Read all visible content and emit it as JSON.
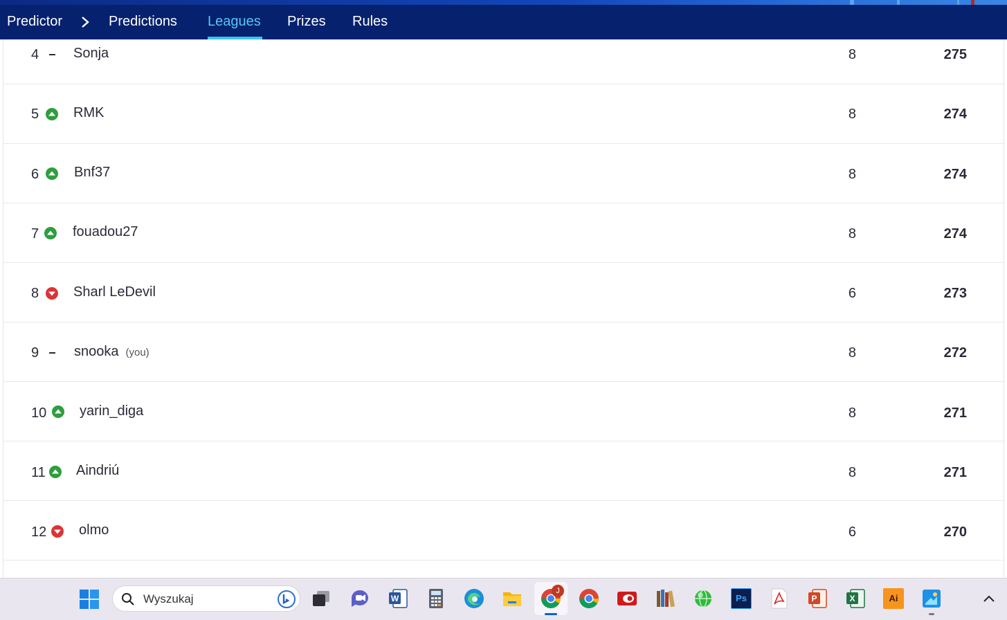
{
  "nav": {
    "breadcrumb_root": "Predictor",
    "tabs": [
      {
        "label": "Predictions",
        "active": false
      },
      {
        "label": "Leagues",
        "active": true
      },
      {
        "label": "Prizes",
        "active": false
      },
      {
        "label": "Rules",
        "active": false
      }
    ]
  },
  "standings": [
    {
      "rank": "4",
      "movement": "same",
      "name": "Sonja",
      "you": "",
      "value": "8",
      "points": "275"
    },
    {
      "rank": "5",
      "movement": "up",
      "name": "RMK",
      "you": "",
      "value": "8",
      "points": "274"
    },
    {
      "rank": "6",
      "movement": "up",
      "name": "Bnf37",
      "you": "",
      "value": "8",
      "points": "274"
    },
    {
      "rank": "7",
      "movement": "up",
      "name": "fouadou27",
      "you": "",
      "value": "8",
      "points": "274"
    },
    {
      "rank": "8",
      "movement": "down",
      "name": "Sharl LeDevil",
      "you": "",
      "value": "6",
      "points": "273"
    },
    {
      "rank": "9",
      "movement": "same",
      "name": "snooka",
      "you": "(you)",
      "value": "8",
      "points": "272"
    },
    {
      "rank": "10",
      "movement": "up",
      "name": "yarin_diga",
      "you": "",
      "value": "8",
      "points": "271"
    },
    {
      "rank": "11",
      "movement": "up",
      "name": "Aindriú",
      "you": "",
      "value": "8",
      "points": "271"
    },
    {
      "rank": "12",
      "movement": "down",
      "name": "olmo",
      "you": "",
      "value": "6",
      "points": "270"
    }
  ],
  "taskbar": {
    "search_placeholder": "Wyszukaj",
    "chrome_badge": "J",
    "apps": [
      "start-icon",
      "search-icon",
      "task-view-icon",
      "teams-chat-icon",
      "word-icon",
      "calculator-icon",
      "edge-icon",
      "file-explorer-icon",
      "chrome-icon",
      "chrome-alt-icon",
      "red-app-icon",
      "library-icon",
      "globe-icon",
      "photoshop-icon",
      "acrobat-icon",
      "powerpoint-icon",
      "excel-icon",
      "illustrator-icon",
      "paint-icon",
      "chevron-up-icon"
    ],
    "ps_label": "Ps",
    "ai_label": "Ai"
  },
  "colors": {
    "nav_bg": "#06216e",
    "nav_active": "#56c8f5",
    "up": "#2e9e3e",
    "down": "#d93535"
  }
}
